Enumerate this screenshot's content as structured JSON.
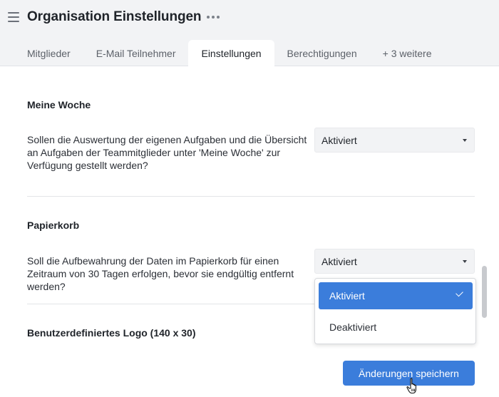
{
  "header": {
    "title": "Organisation Einstellungen",
    "menu_icon": "hamburger-icon",
    "more_icon": "more-horizontal-icon"
  },
  "tabs": [
    {
      "label": "Mitglieder",
      "active": false
    },
    {
      "label": "E-Mail Teilnehmer",
      "active": false
    },
    {
      "label": "Einstellungen",
      "active": true
    },
    {
      "label": "Berechtigungen",
      "active": false
    },
    {
      "label": "+ 3 weitere",
      "active": false
    }
  ],
  "sections": {
    "meine_woche": {
      "title": "Meine Woche",
      "question": "Sollen die Auswertung der eigenen Aufgaben und die Übersicht an Aufgaben der Teammitglieder unter 'Meine Woche' zur Verfügung gestellt werden?",
      "selected": "Aktiviert"
    },
    "papierkorb": {
      "title": "Papierkorb",
      "question": "Soll die Aufbewahrung der Daten im Papierkorb für einen Zeitraum von 30 Tagen erfolgen, bevor sie endgültig entfernt werden?",
      "selected": "Aktiviert"
    },
    "logo": {
      "title": "Benutzerdefiniertes Logo (140 x 30)"
    }
  },
  "dropdown": {
    "options": [
      {
        "label": "Aktiviert",
        "selected": true
      },
      {
        "label": "Deaktiviert",
        "selected": false
      }
    ]
  },
  "save_label": "Änderungen speichern",
  "colors": {
    "accent": "#3b7ddb",
    "header_bg": "#f2f3f5",
    "text": "#1f2329"
  }
}
